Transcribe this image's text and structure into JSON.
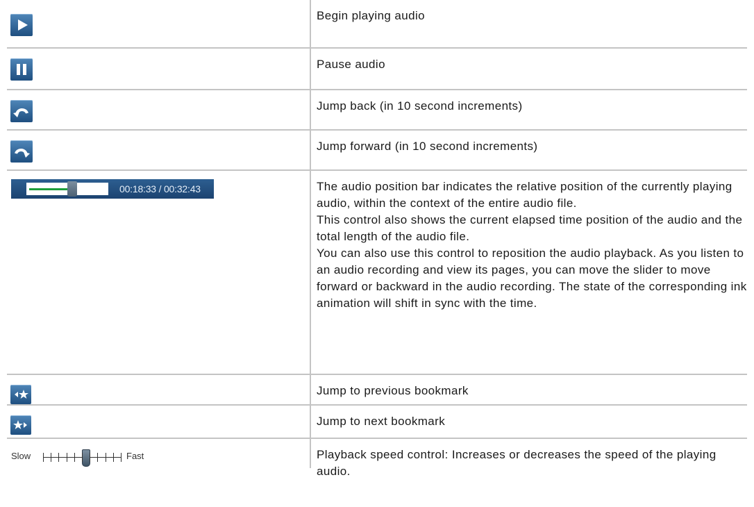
{
  "rows": [
    {
      "icon": "play-icon",
      "desc": [
        "Begin playing audio"
      ]
    },
    {
      "icon": "pause-icon",
      "desc": [
        "Pause audio"
      ]
    },
    {
      "icon": "jump-back-icon",
      "desc": [
        "Jump back (in 10 second increments)"
      ]
    },
    {
      "icon": "jump-forward-icon",
      "desc": [
        "Jump forward (in 10 second increments)"
      ]
    },
    {
      "icon": "audio-position-bar",
      "time": "00:18:33 / 00:32:43",
      "progress": 0.567,
      "desc": [
        "The audio position bar indicates the relative position of the currently playing audio, within the context of the entire audio file.",
        "This control also shows the current elapsed time position of the audio and the total length of the audio file.",
        "You can also use this control to reposition the audio playback. As you listen to an audio recording and view its pages, you can move the slider to move forward or backward in the audio recording. The state of the corresponding ink animation will shift in sync with the time."
      ]
    },
    {
      "icon": "previous-bookmark-icon",
      "desc": [
        "Jump to previous bookmark"
      ]
    },
    {
      "icon": "next-bookmark-icon",
      "desc": [
        "Jump to next bookmark"
      ]
    },
    {
      "icon": "playback-speed-control",
      "slow_label": "Slow",
      "fast_label": "Fast",
      "speed_level": 0.55,
      "desc": [
        "Playback speed control: Increases or decreases the speed of the playing audio."
      ]
    }
  ],
  "colors": {
    "button_top": "#4f86b8",
    "button_bottom": "#1f4f80",
    "progress_fill": "#1e9e3c",
    "divider": "#c4c4c4"
  }
}
